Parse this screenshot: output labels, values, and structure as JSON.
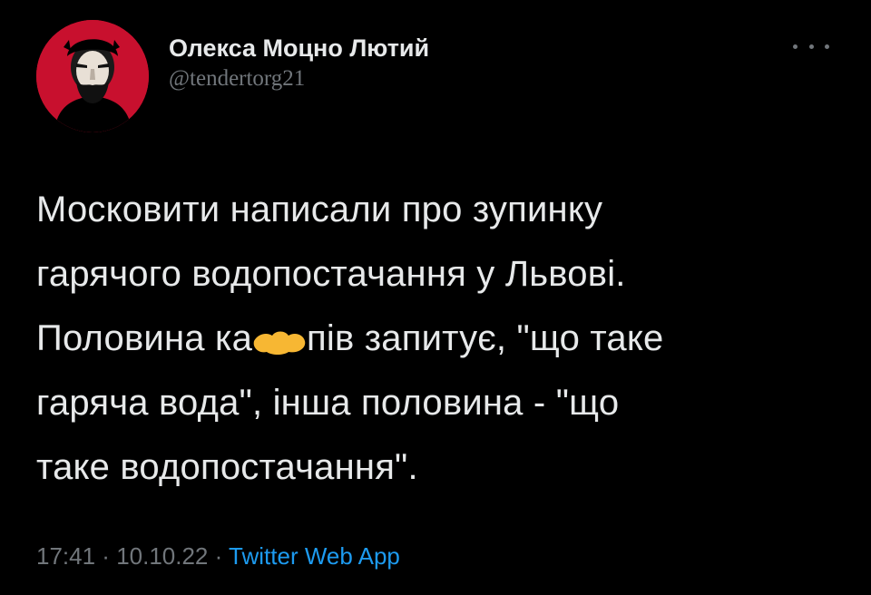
{
  "author": {
    "display_name": "Олекса Моцно Лютий",
    "handle": "@tendertorg21",
    "avatar_icon": "portrait-avatar-icon",
    "avatar_color": "#c8102e"
  },
  "more_icon": "more-options-icon",
  "tweet": {
    "line1": "Московити написали про зупинку",
    "line2": "гарячого водопостачання у Львові.",
    "line3_before": "Половина ка",
    "line3_after": "пів запитує, \"що таке",
    "line4": "гаряча вода\", інша половина - \"що",
    "line5": "таке водопостачання\".",
    "censor_color": "#f7b733"
  },
  "meta": {
    "time": "17:41",
    "separator": " · ",
    "date": "10.10.22",
    "source": "Twitter Web App",
    "source_color": "#1d9bf0"
  }
}
